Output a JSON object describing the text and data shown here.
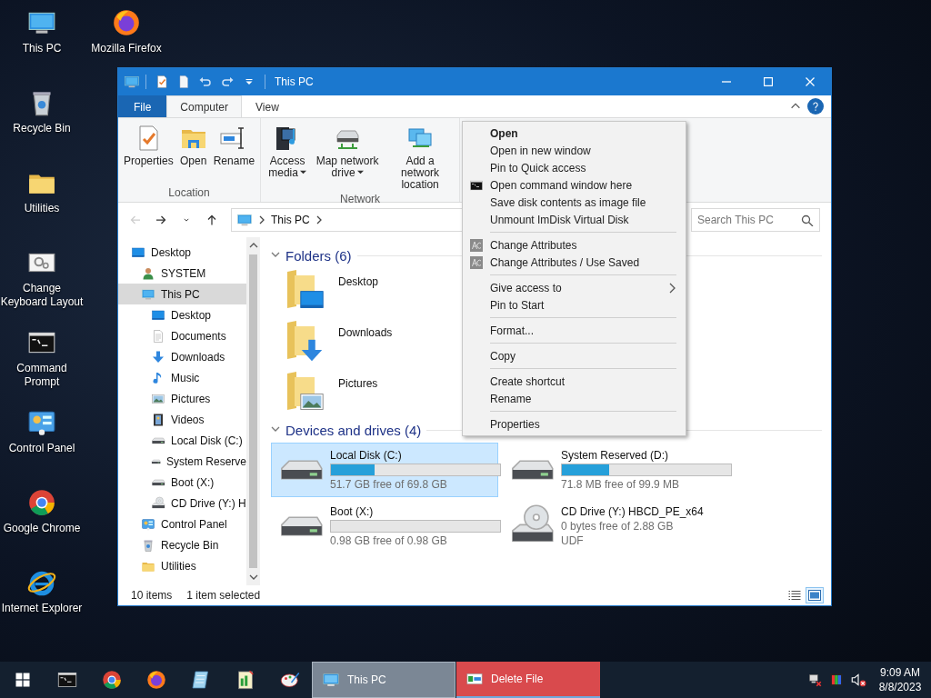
{
  "desktop": {
    "icons": [
      {
        "label": "This PC",
        "kind": "pc"
      },
      {
        "label": "Mozilla Firefox",
        "kind": "firefox"
      },
      {
        "label": "Recycle Bin",
        "kind": "recycle"
      },
      {
        "label": "Utilities",
        "kind": "folder"
      },
      {
        "label": "Change Keyboard Layout",
        "kind": "settings"
      },
      {
        "label": "Command Prompt",
        "kind": "cmd"
      },
      {
        "label": "Control Panel",
        "kind": "control"
      },
      {
        "label": "Google Chrome",
        "kind": "chrome"
      },
      {
        "label": "Internet Explorer",
        "kind": "ie"
      }
    ]
  },
  "window": {
    "title": "This PC",
    "quick_access": [
      {
        "kind": "properties"
      },
      {
        "kind": "newfile"
      },
      {
        "kind": "undo"
      },
      {
        "kind": "redo"
      },
      {
        "kind": "caret"
      }
    ]
  },
  "ribbon": {
    "tabs": [
      {
        "label": "File",
        "kind": "file",
        "selected": false
      },
      {
        "label": "Computer",
        "kind": "tab",
        "selected": true
      },
      {
        "label": "View",
        "kind": "tab",
        "selected": false
      }
    ],
    "groups": [
      {
        "label": "Location",
        "buttons": [
          {
            "label": "Properties",
            "kind": "properties",
            "dropdown": false
          },
          {
            "label": "Open",
            "kind": "open",
            "dropdown": false
          },
          {
            "label": "Rename",
            "kind": "rename",
            "dropdown": false
          }
        ]
      },
      {
        "label": "Network",
        "buttons": [
          {
            "label": "Access media",
            "kind": "media",
            "dropdown": true
          },
          {
            "label": "Map network drive",
            "kind": "mapdrive",
            "dropdown": true
          },
          {
            "label": "Add a network location",
            "kind": "network",
            "dropdown": false
          }
        ]
      }
    ]
  },
  "navigation": {
    "buttons": [
      {
        "kind": "back",
        "disabled": true
      },
      {
        "kind": "forward",
        "disabled": false
      },
      {
        "kind": "recent",
        "disabled": false
      },
      {
        "kind": "up",
        "disabled": false
      }
    ],
    "address": "This PC",
    "search": {
      "placeholder": "Search This PC"
    }
  },
  "sidebar": {
    "items": [
      {
        "label": "Desktop",
        "kind": "desktop",
        "selected": false,
        "children": [
          {
            "label": "SYSTEM",
            "kind": "user",
            "selected": false
          },
          {
            "label": "This PC",
            "kind": "pc",
            "selected": true,
            "children": [
              {
                "label": "Desktop",
                "kind": "desktop",
                "selected": false
              },
              {
                "label": "Documents",
                "kind": "documents",
                "selected": false
              },
              {
                "label": "Downloads",
                "kind": "downloads",
                "selected": false
              },
              {
                "label": "Music",
                "kind": "music",
                "selected": false
              },
              {
                "label": "Pictures",
                "kind": "pictures",
                "selected": false
              },
              {
                "label": "Videos",
                "kind": "videos",
                "selected": false
              },
              {
                "label": "Local Disk (C:)",
                "kind": "hdd",
                "selected": false
              },
              {
                "label": "System Reserve",
                "kind": "hdd",
                "selected": false
              },
              {
                "label": "Boot (X:)",
                "kind": "hdd",
                "selected": false
              },
              {
                "label": "CD Drive (Y:) H",
                "kind": "cd",
                "selected": false
              }
            ]
          },
          {
            "label": "Control Panel",
            "kind": "control",
            "selected": false
          },
          {
            "label": "Recycle Bin",
            "kind": "recycle",
            "selected": false
          },
          {
            "label": "Utilities",
            "kind": "folder",
            "selected": false
          }
        ]
      }
    ]
  },
  "content": {
    "groups": [
      {
        "title": "Folders (6)",
        "kind": "folders",
        "expanded": true,
        "items": [
          {
            "label": "Desktop",
            "kind": "desktop",
            "selected": false
          },
          {
            "label": "Downloads",
            "kind": "downloads",
            "selected": false
          },
          {
            "label": "Pictures",
            "kind": "pictures",
            "selected": false
          }
        ]
      },
      {
        "title": "Devices and drives (4)",
        "kind": "drives",
        "expanded": true,
        "items": [
          {
            "label": "Local Disk (C:)",
            "kind": "hdd",
            "level": 0.26,
            "free": "51.7 GB free of 69.8 GB",
            "selected": true
          },
          {
            "label": "System Reserved (D:)",
            "kind": "hdd",
            "level": 0.28,
            "free": "71.8 MB free of 99.9 MB",
            "selected": false
          },
          {
            "label": "Boot (X:)",
            "kind": "hdd",
            "level": 0,
            "free": "0.98 GB free of 0.98 GB",
            "selected": false
          },
          {
            "label": "CD Drive (Y:) HBCD_PE_x64",
            "kind": "cd",
            "free": "0 bytes free of 2.88 GB",
            "filesystem": "UDF",
            "selected": false
          }
        ]
      }
    ]
  },
  "status_bar": {
    "item_count": "10 items",
    "selection": "1 item selected",
    "views": [
      {
        "kind": "details",
        "selected": false
      },
      {
        "kind": "large",
        "selected": true
      }
    ]
  },
  "context_menu": {
    "items": [
      {
        "kind": "plain",
        "label": "Open",
        "default": true,
        "submenu": false
      },
      {
        "kind": "plain",
        "label": "Open in new window",
        "default": false,
        "submenu": false
      },
      {
        "kind": "plain",
        "label": "Pin to Quick access",
        "default": false,
        "submenu": false
      },
      {
        "kind": "command",
        "label": "Open command window here",
        "default": false,
        "submenu": false
      },
      {
        "kind": "plain",
        "label": "Save disk contents as image file",
        "default": false,
        "submenu": false
      },
      {
        "kind": "plain",
        "label": "Unmount ImDisk Virtual Disk",
        "default": false,
        "submenu": false
      },
      {
        "kind": "separator"
      },
      {
        "kind": "attributes",
        "label": "Change Attributes",
        "default": false,
        "submenu": false
      },
      {
        "kind": "attributes",
        "label": "Change Attributes / Use Saved",
        "default": false,
        "submenu": false
      },
      {
        "kind": "separator"
      },
      {
        "kind": "plain",
        "label": "Give access to",
        "default": false,
        "submenu": true
      },
      {
        "kind": "plain",
        "label": "Pin to Start",
        "default": false,
        "submenu": false
      },
      {
        "kind": "separator"
      },
      {
        "kind": "plain",
        "label": "Format...",
        "default": false,
        "submenu": false
      },
      {
        "kind": "separator"
      },
      {
        "kind": "plain",
        "label": "Copy",
        "default": false,
        "submenu": false
      },
      {
        "kind": "separator"
      },
      {
        "kind": "plain",
        "label": "Create shortcut",
        "default": false,
        "submenu": false
      },
      {
        "kind": "plain",
        "label": "Rename",
        "default": false,
        "submenu": false
      },
      {
        "kind": "separator"
      },
      {
        "kind": "plain",
        "label": "Properties",
        "default": false,
        "submenu": false
      }
    ]
  },
  "taskbar": {
    "pinned": [
      {
        "kind": "cmd"
      },
      {
        "kind": "chrome"
      },
      {
        "kind": "firefox"
      },
      {
        "kind": "notepad"
      },
      {
        "kind": "editor"
      },
      {
        "kind": "paint"
      }
    ],
    "windows": [
      {
        "label": "This PC",
        "kind": "explorer",
        "selected": true,
        "flashing": false
      },
      {
        "label": "Delete File",
        "kind": "app",
        "selected": false,
        "flashing": true
      }
    ],
    "tray": [
      {
        "kind": "network"
      },
      {
        "kind": "display"
      },
      {
        "kind": "volume"
      }
    ],
    "time": "9:09 AM",
    "date": "8/8/2023"
  }
}
